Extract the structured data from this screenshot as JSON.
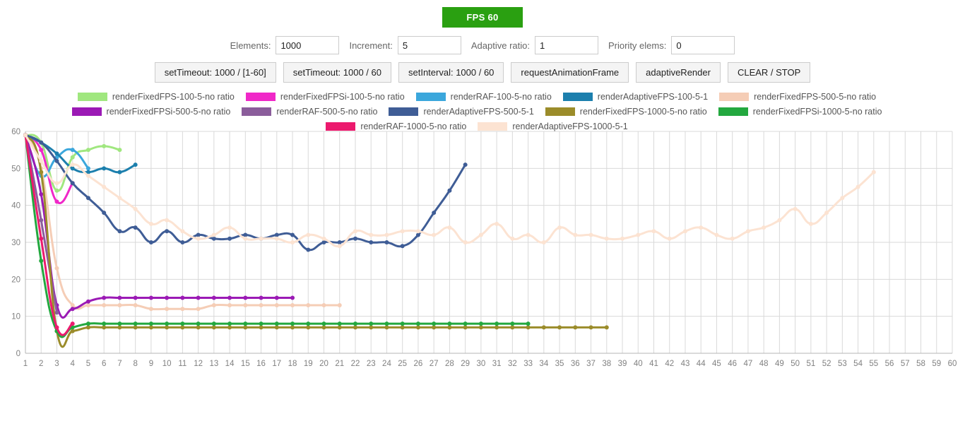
{
  "header": {
    "fps_badge": "FPS 60",
    "fps_badge_color": "#2aa011"
  },
  "controls": {
    "fields": [
      {
        "label": "Elements:",
        "value": "1000",
        "name": "elements"
      },
      {
        "label": "Increment:",
        "value": "5",
        "name": "increment"
      },
      {
        "label": "Adaptive ratio:",
        "value": "1",
        "name": "adaptive-ratio"
      },
      {
        "label": "Priority elems:",
        "value": "0",
        "name": "priority-elems"
      }
    ],
    "buttons": [
      {
        "label": "setTimeout: 1000 / [1-60]",
        "name": "set-timeout-range"
      },
      {
        "label": "setTimeout: 1000 / 60",
        "name": "set-timeout-60"
      },
      {
        "label": "setInterval: 1000 / 60",
        "name": "set-interval-60"
      },
      {
        "label": "requestAnimationFrame",
        "name": "request-animation-frame"
      },
      {
        "label": "adaptiveRender",
        "name": "adaptive-render"
      },
      {
        "label": "CLEAR / STOP",
        "name": "clear-stop"
      }
    ]
  },
  "chart_data": {
    "type": "line",
    "title": "",
    "xlabel": "",
    "ylabel": "",
    "xlim": [
      1,
      60
    ],
    "ylim": [
      0,
      60
    ],
    "yticks": [
      0,
      10,
      20,
      30,
      40,
      50,
      60
    ],
    "xticks": [
      1,
      2,
      3,
      4,
      5,
      6,
      7,
      8,
      9,
      10,
      11,
      12,
      13,
      14,
      15,
      16,
      17,
      18,
      19,
      20,
      21,
      22,
      23,
      24,
      25,
      26,
      27,
      28,
      29,
      30,
      31,
      32,
      33,
      34,
      35,
      36,
      37,
      38,
      39,
      40,
      41,
      42,
      43,
      44,
      45,
      46,
      47,
      48,
      49,
      50,
      51,
      52,
      53,
      54,
      55,
      56,
      57,
      58,
      59,
      60
    ],
    "grid": true,
    "legend_position": "top",
    "markers": true,
    "series": [
      {
        "name": "renderFixedFPS-100-5-no ratio",
        "color": "#a0e77f",
        "x": [
          1,
          2,
          3,
          4,
          5,
          6,
          7
        ],
        "values": [
          59,
          57,
          44,
          53,
          55,
          56,
          55
        ]
      },
      {
        "name": "renderFixedFPSi-100-5-no ratio",
        "color": "#f028c8",
        "x": [
          1,
          2,
          3,
          4
        ],
        "values": [
          59,
          55,
          41,
          46
        ]
      },
      {
        "name": "renderRAF-100-5-no ratio",
        "color": "#3ba7dc",
        "x": [
          1,
          2,
          3,
          4,
          5
        ],
        "values": [
          59,
          48,
          53,
          55,
          50
        ]
      },
      {
        "name": "renderAdaptiveFPS-100-5-1",
        "color": "#1c7fad",
        "x": [
          1,
          2,
          3,
          4,
          5,
          6,
          7,
          8
        ],
        "values": [
          59,
          57,
          54,
          50,
          49,
          50,
          49,
          51
        ]
      },
      {
        "name": "renderFixedFPS-500-5-no ratio",
        "color": "#f5cdb6",
        "x": [
          1,
          2,
          3,
          4,
          5,
          6,
          7,
          8,
          9,
          10,
          11,
          12,
          13,
          14,
          15,
          16,
          17,
          18,
          19,
          20,
          21
        ],
        "values": [
          59,
          50,
          23,
          13,
          13,
          13,
          13,
          13,
          12,
          12,
          12,
          12,
          13,
          13,
          13,
          13,
          13,
          13,
          13,
          13,
          13
        ]
      },
      {
        "name": "renderFixedFPSi-500-5-no ratio",
        "color": "#9b1ab5",
        "x": [
          1,
          2,
          3,
          4,
          5,
          6,
          7,
          8,
          9,
          10,
          11,
          12,
          13,
          14,
          15,
          16,
          17,
          18
        ],
        "values": [
          59,
          43,
          13,
          12,
          14,
          15,
          15,
          15,
          15,
          15,
          15,
          15,
          15,
          15,
          15,
          15,
          15,
          15
        ]
      },
      {
        "name": "renderRAF-500-5-no ratio",
        "color": "#8b5d9b",
        "x": [
          1,
          2,
          3
        ],
        "values": [
          59,
          36,
          11
        ]
      },
      {
        "name": "renderAdaptiveFPS-500-5-1",
        "color": "#3f5d96",
        "x": [
          1,
          2,
          3,
          4,
          5,
          6,
          7,
          8,
          9,
          10,
          11,
          12,
          13,
          14,
          15,
          16,
          17,
          18,
          19,
          20,
          21,
          22,
          23,
          24,
          25,
          26,
          27,
          28,
          29
        ],
        "values": [
          59,
          57,
          52,
          46,
          42,
          38,
          33,
          34,
          30,
          33,
          30,
          32,
          31,
          31,
          32,
          31,
          32,
          32,
          28,
          30,
          30,
          31,
          30,
          30,
          29,
          32,
          38,
          44,
          51
        ]
      },
      {
        "name": "renderFixedFPS-1000-5-no ratio",
        "color": "#9b8c2a",
        "x": [
          1,
          2,
          3,
          4,
          5,
          6,
          7,
          8,
          9,
          10,
          11,
          12,
          13,
          14,
          15,
          16,
          17,
          18,
          19,
          20,
          21,
          22,
          23,
          24,
          25,
          26,
          27,
          28,
          29,
          30,
          31,
          32,
          33,
          34,
          35,
          36,
          37,
          38
        ],
        "values": [
          59,
          49,
          6,
          6,
          7,
          7,
          7,
          7,
          7,
          7,
          7,
          7,
          7,
          7,
          7,
          7,
          7,
          7,
          7,
          7,
          7,
          7,
          7,
          7,
          7,
          7,
          7,
          7,
          7,
          7,
          7,
          7,
          7,
          7,
          7,
          7,
          7,
          7
        ]
      },
      {
        "name": "renderFixedFPSi-1000-5-no ratio",
        "color": "#23a83f",
        "x": [
          1,
          2,
          3,
          4,
          5,
          6,
          7,
          8,
          9,
          10,
          11,
          12,
          13,
          14,
          15,
          16,
          17,
          18,
          19,
          20,
          21,
          22,
          23,
          24,
          25,
          26,
          27,
          28,
          29,
          30,
          31,
          32,
          33
        ],
        "values": [
          59,
          25,
          6,
          7,
          8,
          8,
          8,
          8,
          8,
          8,
          8,
          8,
          8,
          8,
          8,
          8,
          8,
          8,
          8,
          8,
          8,
          8,
          8,
          8,
          8,
          8,
          8,
          8,
          8,
          8,
          8,
          8,
          8
        ]
      },
      {
        "name": "renderRAF-1000-5-no ratio",
        "color": "#ec1a6e",
        "x": [
          1,
          2,
          3,
          4
        ],
        "values": [
          59,
          31,
          7,
          8
        ]
      },
      {
        "name": "renderAdaptiveFPS-1000-5-1",
        "color": "#fce3d2",
        "x": [
          1,
          2,
          3,
          4,
          5,
          6,
          7,
          8,
          9,
          10,
          11,
          12,
          13,
          14,
          15,
          16,
          17,
          18,
          19,
          20,
          21,
          22,
          23,
          24,
          25,
          26,
          27,
          28,
          29,
          30,
          31,
          32,
          33,
          34,
          35,
          36,
          37,
          38,
          39,
          40,
          41,
          42,
          43,
          44,
          45,
          46,
          47,
          48,
          49,
          50,
          51,
          52,
          53,
          54,
          55
        ],
        "values": [
          59,
          52,
          46,
          51,
          48,
          45,
          42,
          39,
          35,
          36,
          33,
          31,
          32,
          34,
          31,
          31,
          31,
          30,
          32,
          31,
          29,
          33,
          32,
          32,
          33,
          33,
          32,
          34,
          30,
          32,
          35,
          31,
          32,
          30,
          34,
          32,
          32,
          31,
          31,
          32,
          33,
          31,
          33,
          34,
          32,
          31,
          33,
          34,
          36,
          39,
          35,
          38,
          42,
          45,
          49
        ]
      }
    ]
  }
}
